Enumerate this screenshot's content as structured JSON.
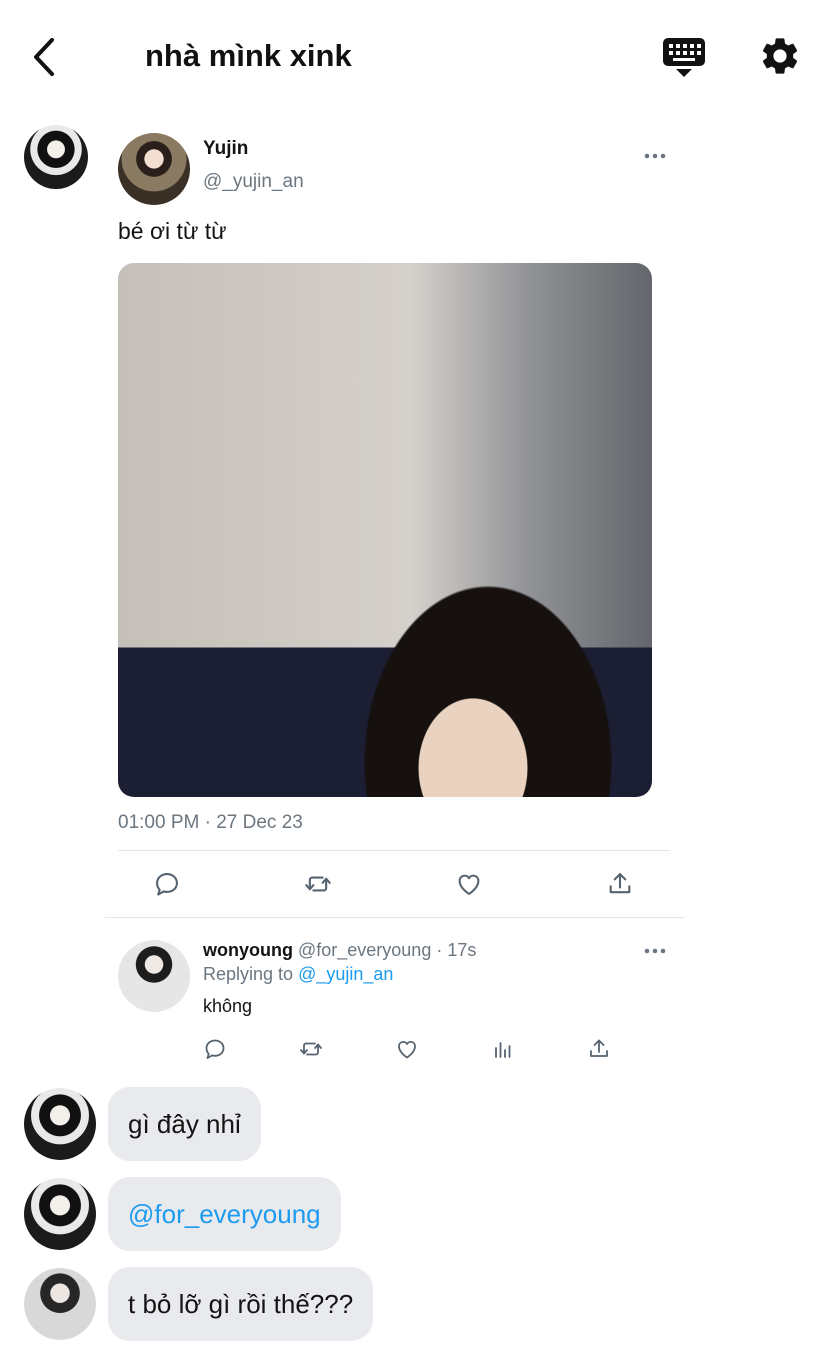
{
  "header": {
    "title": "nhà mìnk xink",
    "back_icon": "chevron-left-icon",
    "keyboard_icon": "keyboard-icon",
    "settings_icon": "gear-icon"
  },
  "tweet": {
    "name": "Yujin",
    "handle": "@_yujin_an",
    "text": "bé ơi từ từ",
    "timestamp": "01:00 PM · 27 Dec 23",
    "actions": [
      "reply-icon",
      "retweet-icon",
      "like-icon",
      "share-icon"
    ]
  },
  "reply": {
    "name": "wonyoung",
    "meta": " @for_everyoung · 17s",
    "replying_prefix": "Replying to ",
    "replying_to": "@_yujin_an",
    "text": "không",
    "actions": [
      "reply-icon",
      "retweet-icon",
      "like-icon",
      "analytics-icon",
      "share-icon"
    ]
  },
  "messages": [
    {
      "text": "gì đây nhỉ",
      "is_mention": false
    },
    {
      "text": "@for_everyoung",
      "is_mention": true
    },
    {
      "text": "t bỏ lỡ gì rồi thế???",
      "is_mention": false
    }
  ],
  "colors": {
    "accent_link": "#1d9bf0",
    "secondary_text": "#6b7680",
    "bubble_bg": "#e8eaed"
  }
}
